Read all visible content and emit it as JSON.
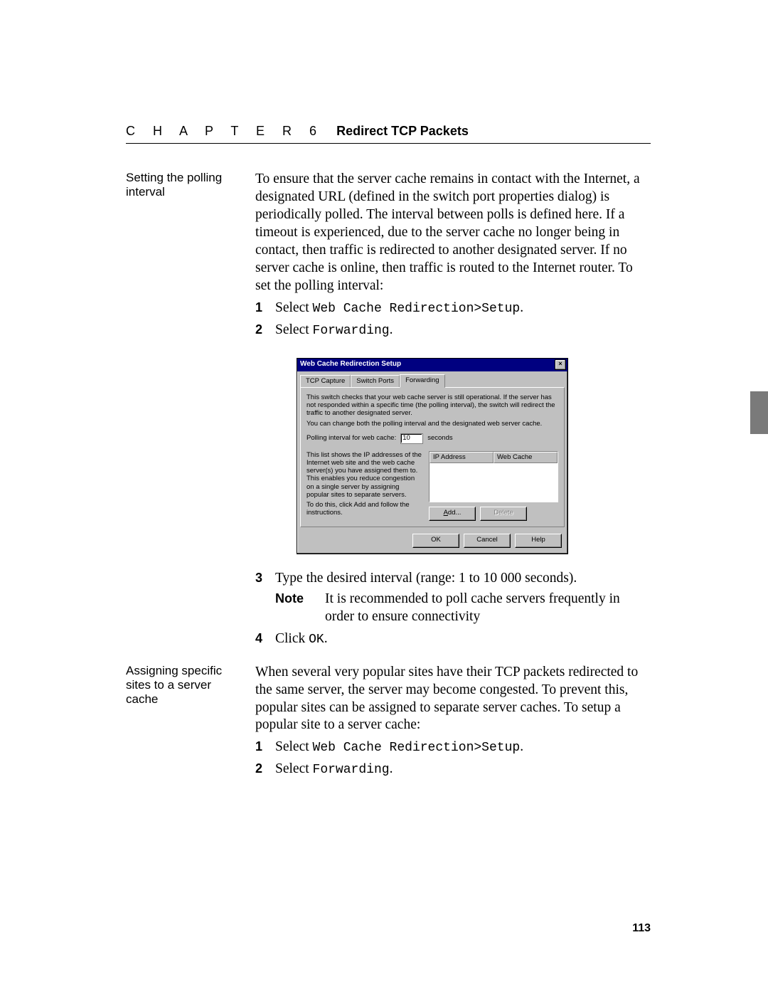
{
  "header": {
    "chapter_prefix": "C H A P T E R   6",
    "title": "Redirect TCP Packets"
  },
  "section1": {
    "label": "Setting the polling interval",
    "para": "To ensure that the server cache remains in contact with the Internet, a designated URL (defined in the switch port properties dialog) is periodically polled. The interval between polls is defined here. If a timeout is experienced, due to the server cache no longer being in contact, then traffic is redirected to another designated server. If no server cache is online, then traffic is routed to the Internet router. To set the polling interval:",
    "step1_num": "1",
    "step1_prefix": "Select ",
    "step1_code": "Web Cache Redirection>Setup",
    "step1_suffix": ".",
    "step2_num": "2",
    "step2_prefix": "Select ",
    "step2_code": "Forwarding",
    "step2_suffix": "."
  },
  "dialog": {
    "title": "Web Cache Redirection Setup",
    "tabs": {
      "tcp": "TCP Capture",
      "ports": "Switch Ports",
      "fwd": "Forwarding"
    },
    "desc1": "This switch checks that your web cache server is still operational. If the server has not responded within a specific time (the polling interval), the switch will redirect the traffic to another designated server.",
    "desc2": "You can change both the polling interval and the designated web server cache.",
    "poll_label": "Polling interval for web cache:",
    "poll_value": "10",
    "poll_unit": "seconds",
    "blurb1": "This list shows the IP addresses of the Internet web site and the web cache server(s) you have assigned them to. This enables you reduce congestion on a single server by assigning popular sites to separate servers.",
    "blurb2": "To do this, click Add and follow the instructions.",
    "col_ip": "IP Address",
    "col_cache": "Web Cache",
    "btn_add": "Add...",
    "btn_delete": "Delete",
    "btn_ok": "OK",
    "btn_cancel": "Cancel",
    "btn_help": "Help"
  },
  "after_dialog": {
    "step3_num": "3",
    "step3_text": "Type the desired interval (range: 1 to 10 000 seconds).",
    "note_label": "Note",
    "note_text": "It is recommended to poll cache servers frequently in order to ensure connectivity",
    "step4_num": "4",
    "step4_prefix": "Click ",
    "step4_code": "OK",
    "step4_suffix": "."
  },
  "section2": {
    "label": "Assigning specific sites to a server cache",
    "para": "When several very popular sites have their TCP packets redirected to the same server, the server may become congested. To prevent this, popular sites can be assigned to separate server caches. To setup a popular site to a server cache:",
    "step1_num": "1",
    "step1_prefix": "Select ",
    "step1_code": "Web Cache Redirection>Setup",
    "step1_suffix": ".",
    "step2_num": "2",
    "step2_prefix": "Select ",
    "step2_code": "Forwarding",
    "step2_suffix": "."
  },
  "page_number": "113"
}
